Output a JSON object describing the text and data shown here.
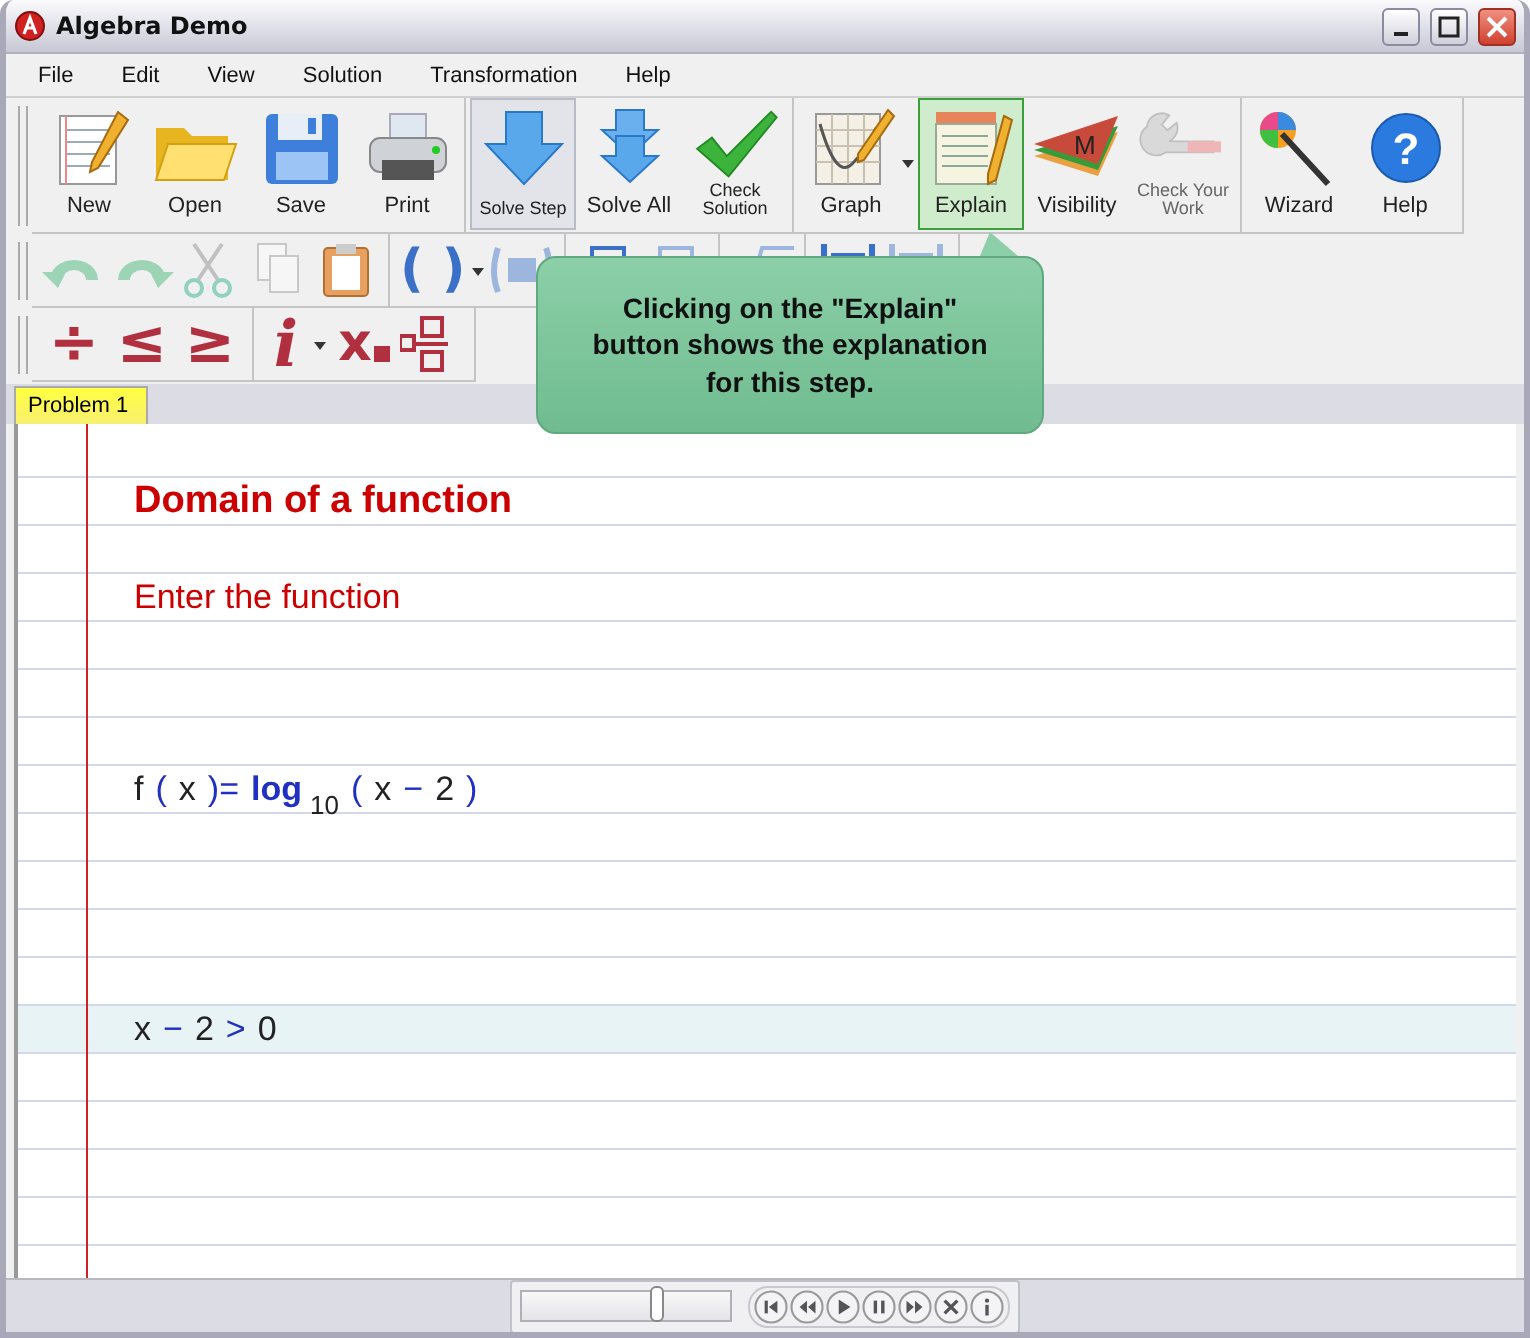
{
  "window": {
    "title": "Algebra Demo"
  },
  "menu": [
    "File",
    "Edit",
    "View",
    "Solution",
    "Transformation",
    "Help"
  ],
  "main_toolbar": [
    {
      "buttons": [
        {
          "label": "New",
          "small": false,
          "hovered": false,
          "selected": false,
          "disabled": false,
          "dropdown": false
        },
        {
          "label": "Open",
          "small": false,
          "hovered": false,
          "selected": false,
          "disabled": false,
          "dropdown": false
        },
        {
          "label": "Save",
          "small": false,
          "hovered": false,
          "selected": false,
          "disabled": false,
          "dropdown": false
        },
        {
          "label": "Print",
          "small": false,
          "hovered": false,
          "selected": false,
          "disabled": false,
          "dropdown": false
        }
      ]
    },
    {
      "buttons": [
        {
          "label": "Solve Step",
          "small": true,
          "hovered": true,
          "selected": false,
          "disabled": false,
          "dropdown": false
        },
        {
          "label": "Solve All",
          "small": false,
          "hovered": false,
          "selected": false,
          "disabled": false,
          "dropdown": false
        },
        {
          "label": "Check Solution",
          "small": true,
          "hovered": false,
          "selected": false,
          "disabled": false,
          "dropdown": false
        }
      ]
    },
    {
      "buttons": [
        {
          "label": "Graph",
          "small": false,
          "hovered": false,
          "selected": false,
          "disabled": false,
          "dropdown": true
        },
        {
          "label": "Explain",
          "small": false,
          "hovered": false,
          "selected": true,
          "disabled": false,
          "dropdown": false
        },
        {
          "label": "Visibility",
          "icon_letter": "M",
          "small": false,
          "hovered": false,
          "selected": false,
          "disabled": false,
          "dropdown": false
        },
        {
          "label": "Check Your Work",
          "small": true,
          "hovered": false,
          "selected": false,
          "disabled": true,
          "dropdown": false
        }
      ]
    },
    {
      "buttons": [
        {
          "label": "Wizard",
          "small": false,
          "hovered": false,
          "selected": false,
          "disabled": false,
          "dropdown": false
        },
        {
          "label": "Help",
          "icon_letter": "?",
          "small": false,
          "hovered": false,
          "selected": false,
          "disabled": false,
          "dropdown": false
        }
      ]
    }
  ],
  "edit_toolbar": [
    {
      "tools": [
        {
          "kind": "icon",
          "disabled": true,
          "dropdown": false
        },
        {
          "kind": "icon",
          "disabled": true,
          "dropdown": false
        },
        {
          "kind": "icon",
          "disabled": true,
          "dropdown": false
        },
        {
          "kind": "icon",
          "disabled": true,
          "dropdown": false
        },
        {
          "kind": "icon",
          "disabled": false,
          "dropdown": false
        }
      ]
    },
    {
      "tools": [
        {
          "kind": "glyph",
          "glyph": "( )",
          "disabled": false,
          "dropdown": true
        },
        {
          "kind": "icon",
          "disabled": true,
          "dropdown": false
        }
      ]
    },
    {
      "tools": [
        {
          "kind": "icon",
          "disabled": false,
          "dropdown": false
        },
        {
          "kind": "icon",
          "disabled": true,
          "dropdown": false
        }
      ]
    },
    {
      "tools": [
        {
          "kind": "icon",
          "disabled": true,
          "dropdown": false
        }
      ]
    },
    {
      "tools": [
        {
          "kind": "icon",
          "disabled": false,
          "dropdown": false
        },
        {
          "kind": "icon",
          "disabled": true,
          "dropdown": false
        }
      ]
    }
  ],
  "symbol_toolbar": [
    {
      "tools": [
        {
          "kind": "glyph",
          "glyph": "÷",
          "disabled": false,
          "dropdown": false
        },
        {
          "kind": "glyph",
          "glyph": "≤",
          "disabled": false,
          "dropdown": false
        },
        {
          "kind": "glyph",
          "glyph": "≥",
          "disabled": false,
          "dropdown": false
        }
      ]
    },
    {
      "tools": [
        {
          "kind": "italic",
          "glyph": "i",
          "disabled": false,
          "dropdown": true
        },
        {
          "kind": "subscript",
          "glyph": "x",
          "disabled": false,
          "dropdown": false
        },
        {
          "kind": "icon",
          "disabled": false,
          "dropdown": false
        }
      ]
    }
  ],
  "tabs": [
    {
      "label": "Problem 1",
      "selected": true
    }
  ],
  "tooltip": {
    "text": "Clicking on the \"Explain\" button shows the explanation for this step."
  },
  "document": {
    "lines": [
      {
        "kind": "heading",
        "text": "Domain of a function",
        "selected": false
      },
      {
        "kind": "instruction",
        "text": "Enter the function",
        "selected": false
      },
      {
        "kind": "formula",
        "selected": false,
        "tokens": [
          {
            "kind": "var",
            "text": "f"
          },
          {
            "kind": "op",
            "text": "("
          },
          {
            "kind": "var",
            "text": "x"
          },
          {
            "kind": "op",
            "text": ")="
          },
          {
            "kind": "func",
            "text": "log"
          },
          {
            "kind": "sub",
            "text": "10"
          },
          {
            "kind": "op",
            "text": "("
          },
          {
            "kind": "var",
            "text": "x"
          },
          {
            "kind": "op",
            "text": "−"
          },
          {
            "kind": "num",
            "text": "2"
          },
          {
            "kind": "op",
            "text": ")"
          }
        ]
      },
      {
        "kind": "formula",
        "selected": true,
        "tokens": [
          {
            "kind": "var",
            "text": "x"
          },
          {
            "kind": "op",
            "text": "−"
          },
          {
            "kind": "num",
            "text": "2"
          },
          {
            "kind": "op",
            "text": ">"
          },
          {
            "kind": "num",
            "text": "0"
          }
        ]
      }
    ]
  },
  "player": {
    "level": 0.65
  }
}
